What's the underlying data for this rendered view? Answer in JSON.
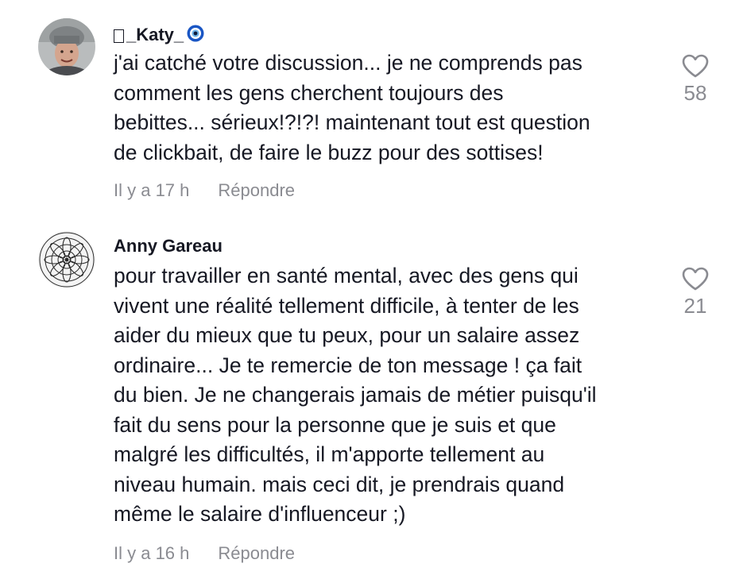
{
  "comments": [
    {
      "username": "_Katy_",
      "text": "j'ai catché votre discussion... je ne comprends pas\ncomment les gens cherchent toujours des\nbebittes... sérieux!?!?! maintenant tout est question\nde clickbait, de faire le buzz pour des sottises!",
      "time": "Il y a 17 h",
      "reply_label": "Répondre",
      "likes": "58",
      "avatar_icon": "person-photo-avatar",
      "badge_icon": "nazar-eye-icon"
    },
    {
      "username": "Anny Gareau",
      "text": "pour travailler en santé mental, avec des gens qui\nvivent une réalité tellement difficile, à tenter de les\naider du mieux que tu peux, pour un salaire assez\nordinaire... Je te remercie de ton message ! ça fait\ndu bien. Je ne changerais jamais de métier puisqu'il\nfait du sens pour la personne que je suis et que\nmalgré les difficultés, il m'apporte tellement au\nniveau humain. mais ceci dit, je prendrais quand\nmême le salaire d'influenceur ;)",
      "time": "Il y a 16 h",
      "reply_label": "Répondre",
      "likes": "21",
      "avatar_icon": "mandala-avatar"
    }
  ],
  "colors": {
    "text": "#161823",
    "muted": "#8a8b91",
    "badge_blue": "#1a56c4"
  }
}
